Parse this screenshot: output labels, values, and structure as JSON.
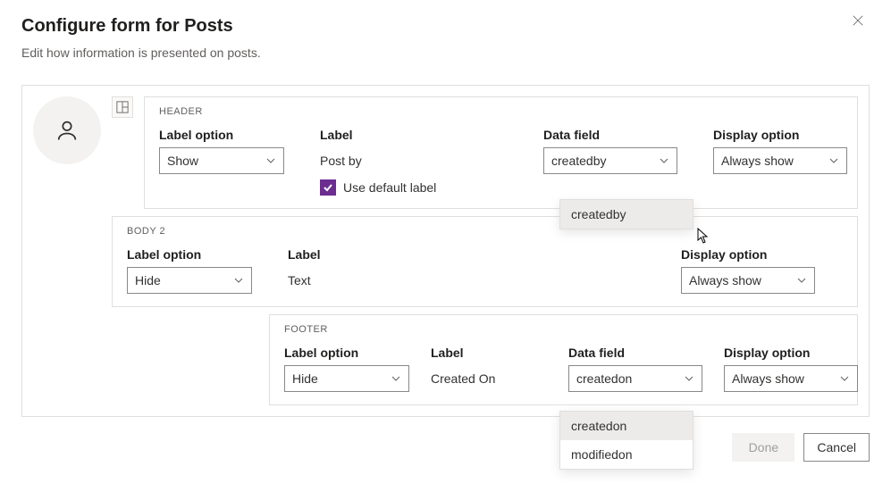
{
  "dialog": {
    "title": "Configure form for Posts",
    "subtitle": "Edit how information is presented on posts."
  },
  "sections": {
    "header": {
      "title": "HEADER",
      "labelOption": {
        "label": "Label option",
        "value": "Show"
      },
      "label": {
        "label": "Label",
        "value": "Post by",
        "useDefault": "Use default label"
      },
      "dataField": {
        "label": "Data field",
        "value": "createdby",
        "options": [
          "createdby"
        ]
      },
      "display": {
        "label": "Display option",
        "value": "Always show"
      }
    },
    "body2": {
      "title": "BODY 2",
      "labelOption": {
        "label": "Label option",
        "value": "Hide"
      },
      "label": {
        "label": "Label",
        "value": "Text"
      },
      "display": {
        "label": "Display option",
        "value": "Always show"
      }
    },
    "footer": {
      "title": "FOOTER",
      "labelOption": {
        "label": "Label option",
        "value": "Hide"
      },
      "label": {
        "label": "Label",
        "value": "Created On"
      },
      "dataField": {
        "label": "Data field",
        "value": "createdon",
        "options": [
          "createdon",
          "modifiedon"
        ]
      },
      "display": {
        "label": "Display option",
        "value": "Always show"
      }
    }
  },
  "actions": {
    "done": "Done",
    "cancel": "Cancel"
  }
}
